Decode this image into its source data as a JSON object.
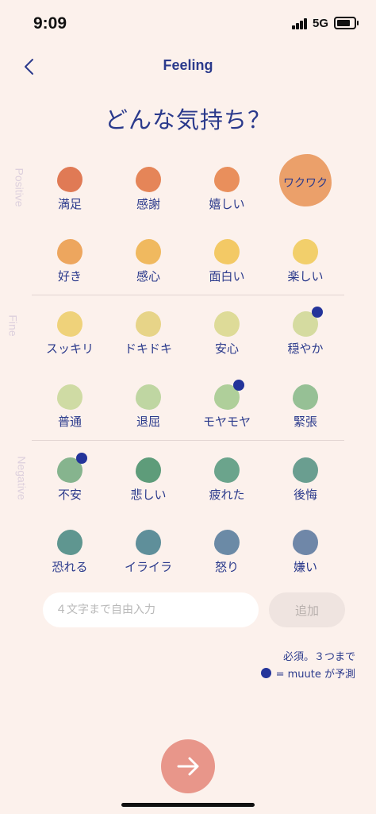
{
  "status": {
    "time": "9:09",
    "network": "5G"
  },
  "nav": {
    "title": "Feeling",
    "back_icon": "chevron-left-icon"
  },
  "question": "どんな気持ち？",
  "sections": {
    "positive": "Positive",
    "fine": "Fine",
    "negative": "Negative"
  },
  "moods": [
    {
      "label": "満足",
      "color": "#e07a55",
      "predicted": false,
      "selected": false
    },
    {
      "label": "感謝",
      "color": "#e58558",
      "predicted": false,
      "selected": false
    },
    {
      "label": "嬉しい",
      "color": "#e98f5c",
      "predicted": false,
      "selected": false
    },
    {
      "label": "ワクワク",
      "color": "#eba06a",
      "predicted": false,
      "selected": true
    },
    {
      "label": "好き",
      "color": "#eda65e",
      "predicted": false,
      "selected": false
    },
    {
      "label": "感心",
      "color": "#f0b95f",
      "predicted": false,
      "selected": false
    },
    {
      "label": "面白い",
      "color": "#f3c965",
      "predicted": false,
      "selected": false
    },
    {
      "label": "楽しい",
      "color": "#f2cf6b",
      "predicted": false,
      "selected": false
    },
    {
      "label": "スッキリ",
      "color": "#efd27a",
      "predicted": false,
      "selected": false
    },
    {
      "label": "ドキドキ",
      "color": "#e7d488",
      "predicted": false,
      "selected": false
    },
    {
      "label": "安心",
      "color": "#dedb98",
      "predicted": false,
      "selected": false
    },
    {
      "label": "穏やか",
      "color": "#d5dba0",
      "predicted": true,
      "selected": false
    },
    {
      "label": "普通",
      "color": "#cfdba4",
      "predicted": false,
      "selected": false
    },
    {
      "label": "退屈",
      "color": "#bfd6a2",
      "predicted": false,
      "selected": false
    },
    {
      "label": "モヤモヤ",
      "color": "#afcf9a",
      "predicted": true,
      "selected": false
    },
    {
      "label": "緊張",
      "color": "#96c095",
      "predicted": false,
      "selected": false
    },
    {
      "label": "不安",
      "color": "#86b48e",
      "predicted": true,
      "selected": false
    },
    {
      "label": "悲しい",
      "color": "#5e9c7a",
      "predicted": false,
      "selected": false
    },
    {
      "label": "疲れた",
      "color": "#6ba48c",
      "predicted": false,
      "selected": false
    },
    {
      "label": "後悔",
      "color": "#6a9e90",
      "predicted": false,
      "selected": false
    },
    {
      "label": "恐れる",
      "color": "#5f9690",
      "predicted": false,
      "selected": false
    },
    {
      "label": "イライラ",
      "color": "#5f8f9a",
      "predicted": false,
      "selected": false
    },
    {
      "label": "怒り",
      "color": "#6b8aa6",
      "predicted": false,
      "selected": false
    },
    {
      "label": "嫌い",
      "color": "#6f87a8",
      "predicted": false,
      "selected": false
    }
  ],
  "input": {
    "placeholder": "４文字まで自由入力",
    "value": ""
  },
  "add_button": "追加",
  "note_required": "必須。３つまで",
  "note_predicted": "= muute が予測",
  "next_icon": "arrow-right-icon",
  "colors": {
    "accent": "#2b3a8c",
    "next": "#e8968a",
    "background": "#fcf1ec",
    "predicted_dot": "#24349a"
  }
}
